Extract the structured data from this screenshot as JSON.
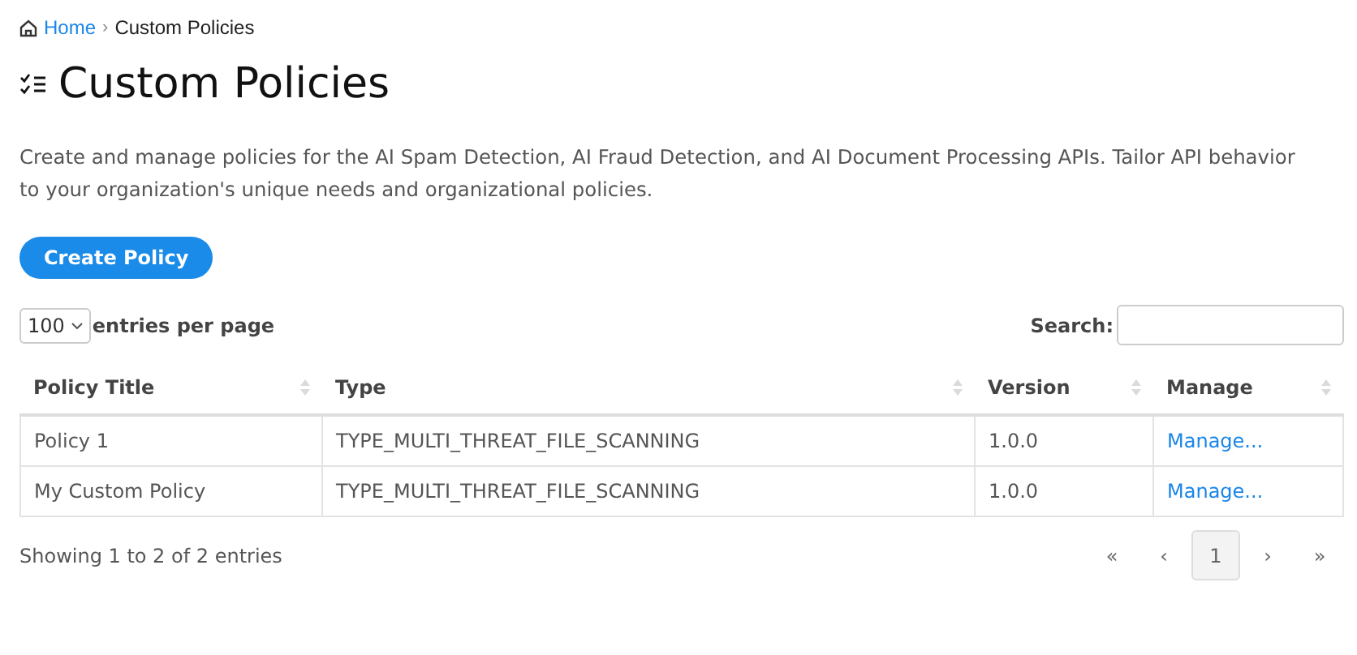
{
  "breadcrumb": {
    "items": [
      {
        "label": "Home",
        "kind": "link"
      },
      {
        "label": "Custom Policies",
        "kind": "current"
      }
    ],
    "separator": "›"
  },
  "title": "Custom Policies",
  "description": "Create and manage policies for the AI Spam Detection, AI Fraud Detection, and AI Document Processing APIs. Tailor API behavior to your organization's unique needs and organizational policies.",
  "create_button": "Create Policy",
  "page_size": {
    "value": "100",
    "label": "entries per page"
  },
  "search": {
    "label": "Search:"
  },
  "table": {
    "columns": [
      "Policy Title",
      "Type",
      "Version",
      "Manage"
    ],
    "rows": [
      {
        "cells": [
          "Policy 1",
          "TYPE_MULTI_THREAT_FILE_SCANNING",
          "1.0.0"
        ],
        "link": "Manage..."
      },
      {
        "cells": [
          "My Custom Policy",
          "TYPE_MULTI_THREAT_FILE_SCANNING",
          "1.0.0"
        ],
        "link": "Manage..."
      }
    ]
  },
  "info": "Showing 1 to 2 of 2 entries",
  "pagination": [
    {
      "label": "«",
      "selected": false
    },
    {
      "label": "‹",
      "selected": false
    },
    {
      "label": "1",
      "selected": true
    },
    {
      "label": "›",
      "selected": false
    },
    {
      "label": "»",
      "selected": false
    }
  ]
}
